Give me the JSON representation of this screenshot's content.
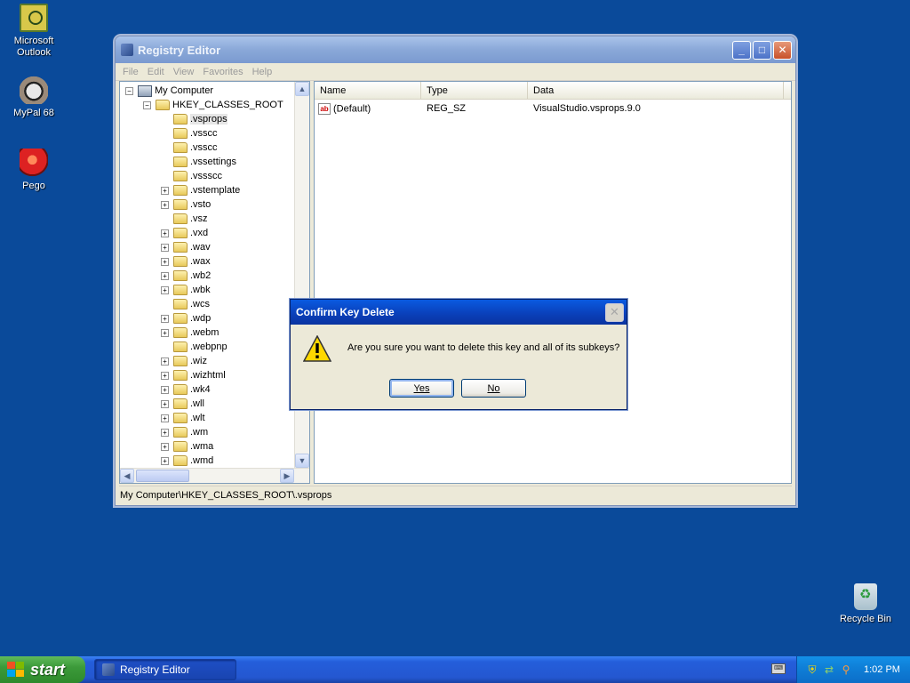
{
  "desktop": {
    "icons": [
      {
        "label_line1": "Microsoft",
        "label_line2": "Outlook",
        "icon": "outlook-icon"
      },
      {
        "label": "MyPal 68",
        "icon": "mypal-icon"
      },
      {
        "label": "Pego",
        "icon": "pego-icon"
      },
      {
        "label": "Recycle Bin",
        "icon": "recycle-bin-icon"
      }
    ]
  },
  "window": {
    "title": "Registry Editor",
    "controls": {
      "minimize": "_",
      "maximize": "□",
      "close": "✕"
    },
    "menu": [
      "File",
      "Edit",
      "View",
      "Favorites",
      "Help"
    ],
    "tree": {
      "root": "My Computer",
      "hive": "HKEY_CLASSES_ROOT",
      "keys": [
        {
          "name": ".vsprops",
          "expandable": false,
          "selected": true
        },
        {
          "name": ".vsscc",
          "expandable": false
        },
        {
          "name": ".vsscc",
          "expandable": false
        },
        {
          "name": ".vssettings",
          "expandable": false
        },
        {
          "name": ".vssscc",
          "expandable": false
        },
        {
          "name": ".vstemplate",
          "expandable": true
        },
        {
          "name": ".vsto",
          "expandable": true
        },
        {
          "name": ".vsz",
          "expandable": false
        },
        {
          "name": ".vxd",
          "expandable": true
        },
        {
          "name": ".wav",
          "expandable": true
        },
        {
          "name": ".wax",
          "expandable": true
        },
        {
          "name": ".wb2",
          "expandable": true
        },
        {
          "name": ".wbk",
          "expandable": true
        },
        {
          "name": ".wcs",
          "expandable": false
        },
        {
          "name": ".wdp",
          "expandable": true
        },
        {
          "name": ".webm",
          "expandable": true
        },
        {
          "name": ".webpnp",
          "expandable": false
        },
        {
          "name": ".wiz",
          "expandable": true
        },
        {
          "name": ".wizhtml",
          "expandable": true
        },
        {
          "name": ".wk4",
          "expandable": true
        },
        {
          "name": ".wll",
          "expandable": true
        },
        {
          "name": ".wlt",
          "expandable": true
        },
        {
          "name": ".wm",
          "expandable": true
        },
        {
          "name": ".wma",
          "expandable": true
        },
        {
          "name": ".wmd",
          "expandable": true
        }
      ]
    },
    "list": {
      "columns": [
        "Name",
        "Type",
        "Data"
      ],
      "rows": [
        {
          "name": "(Default)",
          "type": "REG_SZ",
          "data": "VisualStudio.vsprops.9.0"
        }
      ]
    },
    "status": "My Computer\\HKEY_CLASSES_ROOT\\.vsprops"
  },
  "dialog": {
    "title": "Confirm Key Delete",
    "message": "Are you sure you want to delete this key and all of its subkeys?",
    "yes_label": "Yes",
    "no_label": "No",
    "icon": "warning-icon"
  },
  "taskbar": {
    "start_label": "start",
    "task_label": "Registry Editor",
    "clock": "1:02 PM"
  }
}
